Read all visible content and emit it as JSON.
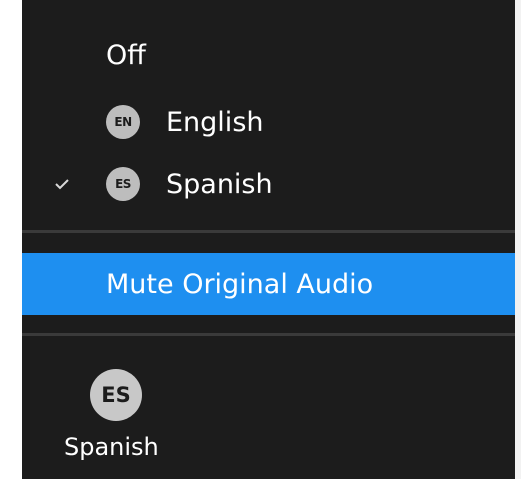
{
  "menu": {
    "items": [
      {
        "label": "Off",
        "badge": "",
        "checked": false
      },
      {
        "label": "English",
        "badge": "EN",
        "checked": false
      },
      {
        "label": "Spanish",
        "badge": "ES",
        "checked": true
      }
    ],
    "mute_label": "Mute Original Audio",
    "check_icon": "checkmark-icon"
  },
  "bottom": {
    "badge": "ES",
    "label": "Spanish"
  },
  "colors": {
    "menu_bg": "#1c1c1c",
    "highlight": "#1e8ff0",
    "badge_bg": "#bdbdbd",
    "text": "#ffffff"
  }
}
